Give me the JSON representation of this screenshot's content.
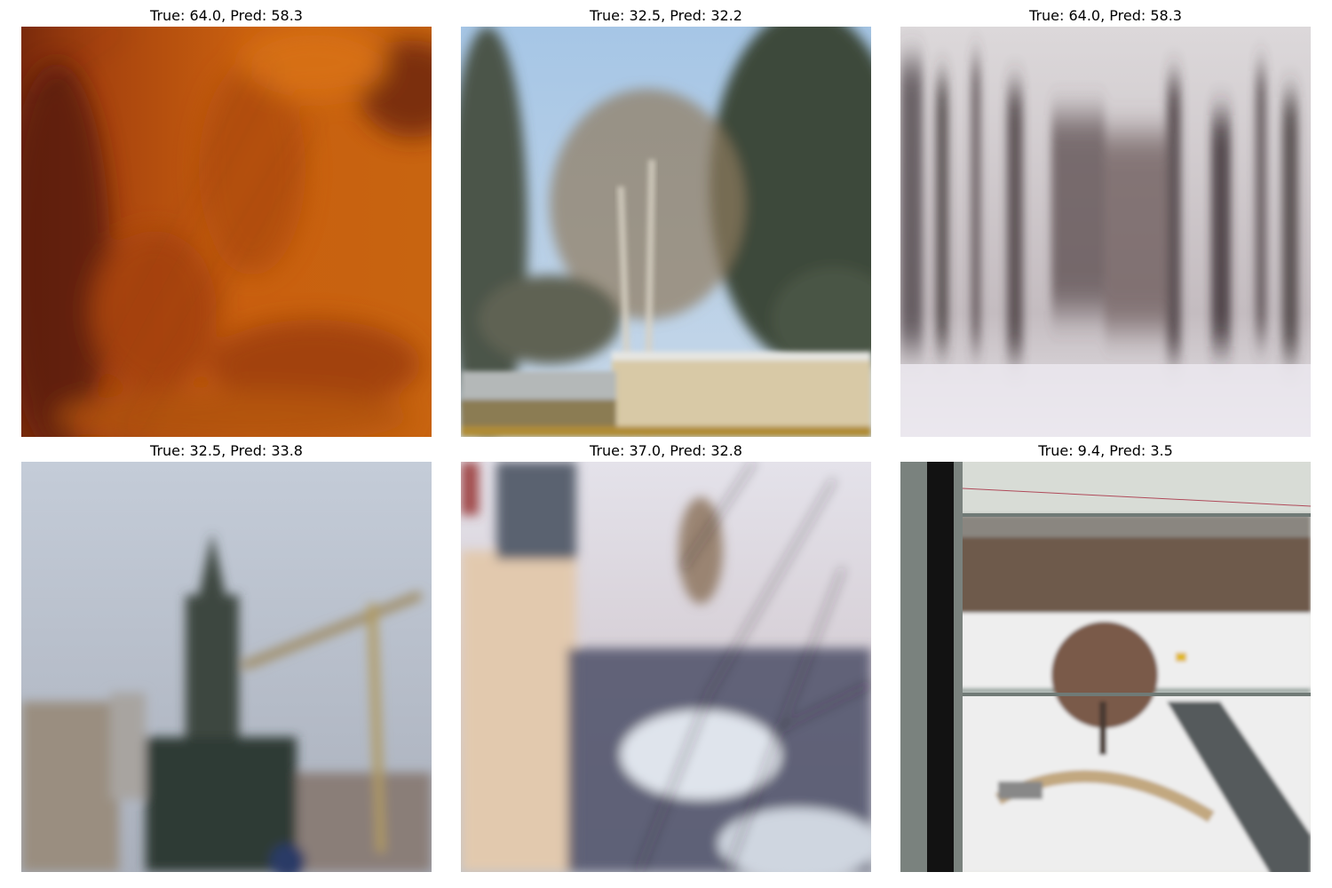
{
  "panels": [
    {
      "title": "True: 64.0, Pred: 58.3",
      "image": "blurred orange autumn foliage (motion blur)"
    },
    {
      "title": "True: 32.5, Pred: 32.2",
      "image": "blurred bare tree and fir trees with blue sky and wall"
    },
    {
      "title": "True: 64.0, Pred: 58.3",
      "image": "vertically motion-blurred snowy forest with house"
    },
    {
      "title": "True: 32.5, Pred: 33.8",
      "image": "out-of-focus church tower and construction crane on grey sky"
    },
    {
      "title": "True: 37.0, Pred: 32.8",
      "image": "motion-blurred building facade and bare tree branches over snow"
    },
    {
      "title": "True: 9.4, Pred: 3.5",
      "image": "snowy park viewed through window with tree and walkway"
    }
  ],
  "colors": {
    "background": "#ffffff",
    "title_text": "#000000"
  }
}
